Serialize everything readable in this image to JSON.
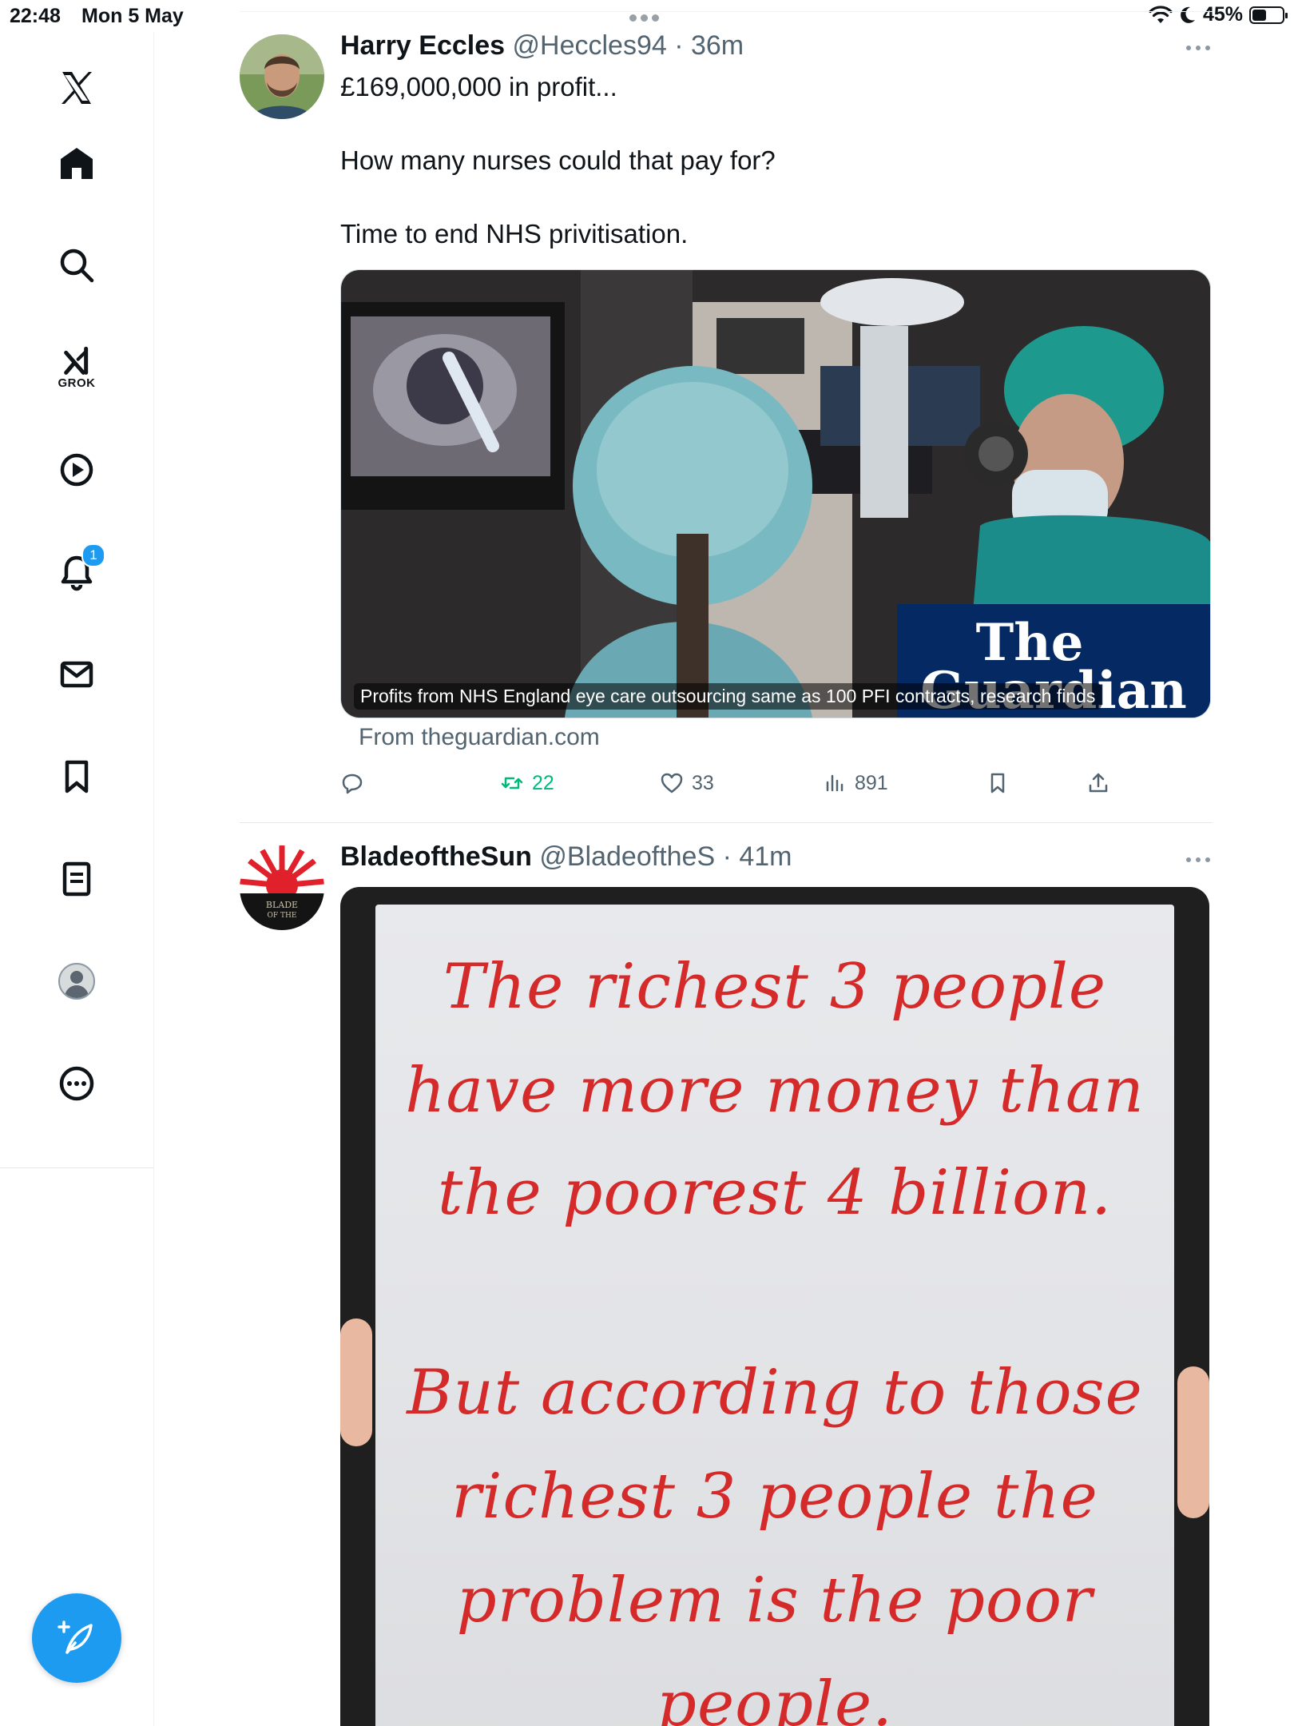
{
  "status_bar": {
    "time": "22:48",
    "date": "Mon 5 May",
    "battery": "45%"
  },
  "sidebar": {
    "items": [
      {
        "name": "x-logo-icon"
      },
      {
        "name": "home-icon"
      },
      {
        "name": "search-icon"
      },
      {
        "name": "grok-icon",
        "label": "GROK"
      },
      {
        "name": "video-icon"
      },
      {
        "name": "notifications-icon",
        "badge": "1"
      },
      {
        "name": "messages-icon"
      },
      {
        "name": "bookmarks-icon"
      },
      {
        "name": "lists-icon"
      },
      {
        "name": "profile-icon"
      },
      {
        "name": "more-icon"
      }
    ],
    "compose": {
      "name": "compose-icon"
    }
  },
  "tweets": [
    {
      "name": "Harry Eccles",
      "handle": "@Heccles94",
      "time": "36m",
      "text": [
        "£169,000,000 in profit...",
        "How many nurses could that pay for?",
        "Time to end NHS privitisation."
      ],
      "card": {
        "caption": "Profits from NHS England eye care outsourcing same as 100 PFI contracts, research finds",
        "logo_line1": "The",
        "logo_line2": "Guardian",
        "source": "From theguardian.com"
      },
      "actions": {
        "retweets": "22",
        "likes": "33",
        "views": "891"
      }
    },
    {
      "name": "BladeoftheSun",
      "handle": "@BladeoftheS",
      "time": "41m",
      "avatar_text": [
        "BLADE",
        "OF THE"
      ],
      "image_text": [
        "The richest 3 people",
        "have more money than",
        "the poorest 4 billion.",
        "But according to those",
        "richest 3 people the",
        "problem is the poor",
        "people."
      ]
    }
  ],
  "colors": {
    "accent": "#1d9bf0",
    "retweet_green": "#00ba7c",
    "secondary_text": "#536471",
    "guardian_blue": "#052962",
    "whiteboard_ink": "#d42a2a"
  }
}
